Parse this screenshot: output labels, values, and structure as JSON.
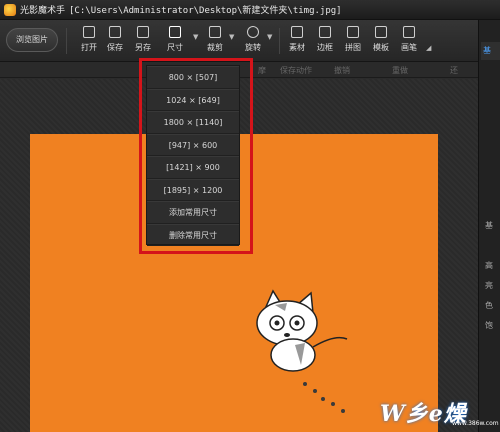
{
  "window": {
    "app_name": "光影魔术手",
    "path": "[C:\\Users\\Administrator\\Desktop\\新建文件夹\\timg.jpg]"
  },
  "toolbar": {
    "browse_label": "浏览图片",
    "tools": [
      {
        "label": "打开",
        "icon": "open-icon"
      },
      {
        "label": "保存",
        "icon": "save-icon"
      },
      {
        "label": "另存",
        "icon": "save-as-icon"
      },
      {
        "label": "尺寸",
        "icon": "resize-icon"
      },
      {
        "label": "裁剪",
        "icon": "crop-icon"
      },
      {
        "label": "旋转",
        "icon": "rotate-icon"
      },
      {
        "label": "素材",
        "icon": "star-icon"
      },
      {
        "label": "边框",
        "icon": "frame-icon"
      },
      {
        "label": "拼图",
        "icon": "collage-icon"
      },
      {
        "label": "模板",
        "icon": "template-icon"
      },
      {
        "label": "画笔",
        "icon": "brush-icon"
      }
    ]
  },
  "subbar": {
    "items": [
      "摩",
      "保存动作",
      "撤销",
      "重做",
      "还"
    ]
  },
  "size_dropdown": {
    "items": [
      "800 × [507]",
      "1024 × [649]",
      "1800 × [1140]",
      "[947] × 600",
      "[1421] × 900",
      "[1895] × 1200",
      "添加常用尺寸",
      "删除常用尺寸"
    ]
  },
  "right_panel": {
    "tab": "基",
    "labels": [
      "基",
      "高",
      "亮",
      "色",
      "饱"
    ]
  },
  "watermark": {
    "text": "W乡e燥",
    "url": "www.386w.com"
  },
  "colors": {
    "photo_bg": "#f08121",
    "highlight": "#d4141a",
    "accent": "#4da3ff"
  }
}
